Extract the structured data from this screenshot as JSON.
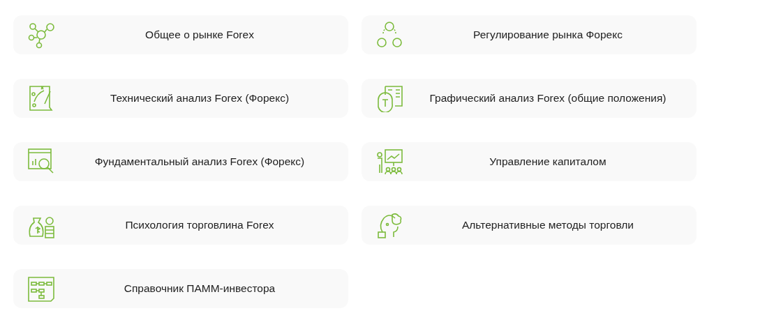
{
  "topics": [
    {
      "label": "Общее о рынке Forex"
    },
    {
      "label": "Регулирование рынка Форекс"
    },
    {
      "label": "Технический анализ Forex (Форекс)"
    },
    {
      "label": "Графический анализ Forex (общие положения)"
    },
    {
      "label": "Фундаментальный анализ Forex (Форекс)"
    },
    {
      "label": "Управление капиталом"
    },
    {
      "label": "Психология торговлина Forex"
    },
    {
      "label": "Альтернативные методы торговли"
    },
    {
      "label": "Справочник ПАММ-инвестора"
    }
  ]
}
